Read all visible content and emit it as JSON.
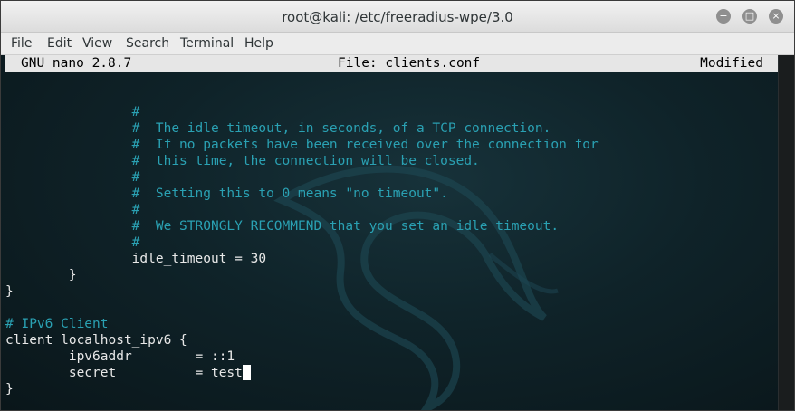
{
  "window": {
    "title": "root@kali: /etc/freeradius-wpe/3.0",
    "buttons": {
      "minimize": "−",
      "maximize": "□",
      "close": "×"
    }
  },
  "menu": [
    "File",
    "Edit",
    "View",
    "Search",
    "Terminal",
    "Help"
  ],
  "nano": {
    "version": "GNU nano 2.8.7",
    "file": "File: clients.conf",
    "status": "Modified"
  },
  "lines": [
    {
      "kind": "comment",
      "text": "                #"
    },
    {
      "kind": "comment",
      "text": "                #  The idle timeout, in seconds, of a TCP connection."
    },
    {
      "kind": "comment",
      "text": "                #  If no packets have been received over the connection for"
    },
    {
      "kind": "comment",
      "text": "                #  this time, the connection will be closed."
    },
    {
      "kind": "comment",
      "text": "                #"
    },
    {
      "kind": "comment",
      "text": "                #  Setting this to 0 means \"no timeout\"."
    },
    {
      "kind": "comment",
      "text": "                #"
    },
    {
      "kind": "comment",
      "text": "                #  We STRONGLY RECOMMEND that you set an idle timeout."
    },
    {
      "kind": "comment",
      "text": "                #"
    },
    {
      "kind": "code",
      "text": "                idle_timeout = 30"
    },
    {
      "kind": "code",
      "text": "        }"
    },
    {
      "kind": "code",
      "text": "}"
    },
    {
      "kind": "code",
      "text": ""
    },
    {
      "kind": "comment",
      "text": "# IPv6 Client"
    },
    {
      "kind": "code",
      "text": "client localhost_ipv6 {"
    },
    {
      "kind": "code",
      "text": "        ipv6addr        = ::1"
    },
    {
      "kind": "code",
      "text": "        secret          = test"
    },
    {
      "kind": "code",
      "text": "}"
    }
  ]
}
